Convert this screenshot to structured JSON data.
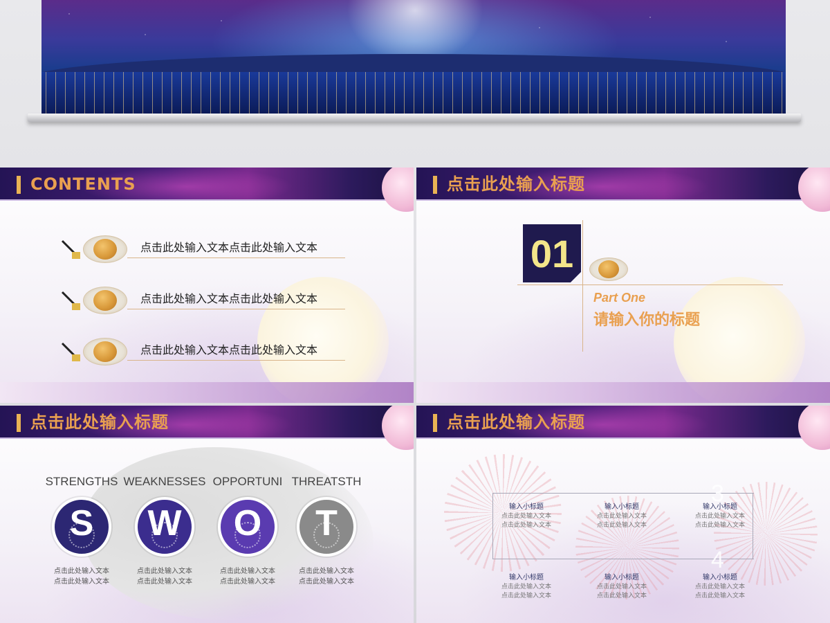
{
  "slide_contents": {
    "title": "CONTENTS",
    "items": [
      "点击此处输入文本点击此处输入文本",
      "点击此处输入文本点击此处输入文本",
      "点击此处输入文本点击此处输入文本"
    ]
  },
  "slide_part": {
    "title": "点击此处输入标题",
    "number": "01",
    "part_en": "Part One",
    "part_cn": "请输入你的标题"
  },
  "slide_swot": {
    "title": "点击此处输入标题",
    "items": [
      {
        "label": "STRENGTHS",
        "letter": "S",
        "color": "#2c2773",
        "desc1": "点击此处输入文本",
        "desc2": "点击此处输入文本"
      },
      {
        "label": "WEAKNESSES",
        "letter": "W",
        "color": "#3b2d8e",
        "desc1": "点击此处输入文本",
        "desc2": "点击此处输入文本"
      },
      {
        "label": "OPPORTUNI",
        "letter": "O",
        "color": "#5a3bb0",
        "desc1": "点击此处输入文本",
        "desc2": "点击此处输入文本"
      },
      {
        "label": "THREATSTH",
        "letter": "T",
        "color": "#8a8a8a",
        "desc1": "点击此处输入文本",
        "desc2": "点击此处输入文本"
      }
    ]
  },
  "slide_process": {
    "title": "点击此处输入标题",
    "nodes": [
      {
        "title": "输入小标题",
        "d1": "点击此处输入文本",
        "d2": "点击此处输入文本"
      },
      {
        "title": "输入小标题",
        "d1": "点击此处输入文本",
        "d2": "点击此处输入文本"
      },
      {
        "title": "输入小标题",
        "d1": "点击此处输入文本",
        "d2": "点击此处输入文本"
      },
      {
        "title": "输入小标题",
        "d1": "点击此处输入文本",
        "d2": "点击此处输入文本"
      },
      {
        "title": "输入小标题",
        "d1": "点击此处输入文本",
        "d2": "点击此处输入文本"
      },
      {
        "title": "输入小标题",
        "d1": "点击此处输入文本",
        "d2": "点击此处输入文本"
      }
    ],
    "step_numbers": [
      "3",
      "4"
    ]
  }
}
